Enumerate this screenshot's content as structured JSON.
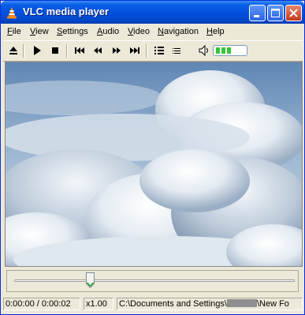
{
  "window": {
    "title": "VLC media player"
  },
  "menu": [
    {
      "accel": "F",
      "rest": "ile"
    },
    {
      "accel": "V",
      "rest": "iew"
    },
    {
      "accel": "S",
      "rest": "ettings"
    },
    {
      "accel": "A",
      "rest": "udio"
    },
    {
      "accel": "V",
      "rest": "ideo"
    },
    {
      "accel": "N",
      "rest": "avigation"
    },
    {
      "accel": "H",
      "rest": "elp"
    }
  ],
  "playback": {
    "position": 0.27,
    "volume_segments_filled": 3
  },
  "status": {
    "time": "0:00:00 / 0:00:02",
    "speed": "x1.00",
    "path_prefix": "C:\\Documents and Settings\\",
    "path_suffix": "\\New Fo"
  }
}
